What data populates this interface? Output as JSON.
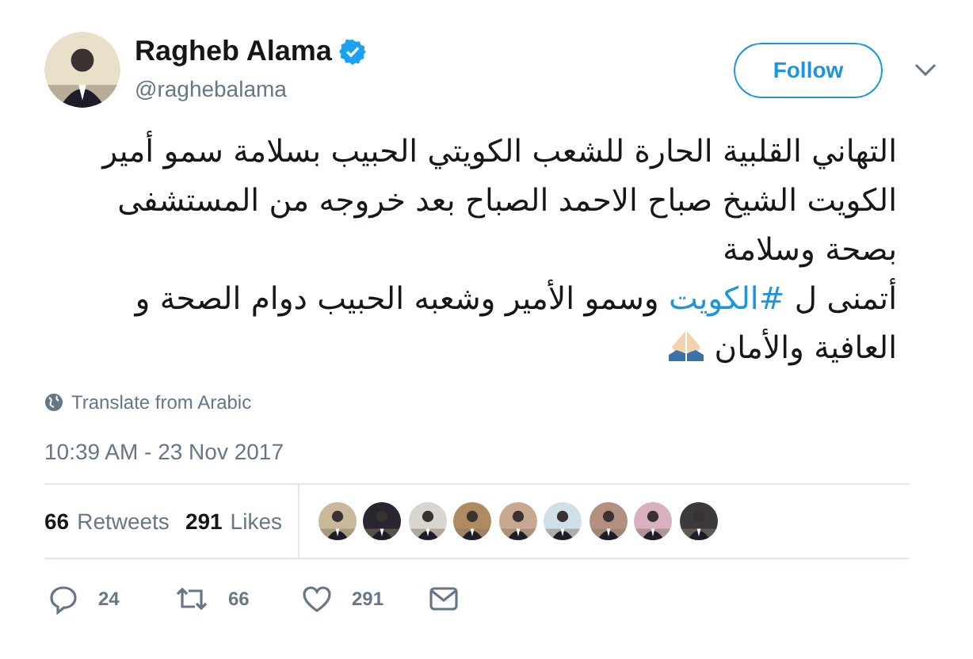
{
  "author": {
    "name": "Ragheb Alama",
    "verified": true,
    "handle": "@raghebalama"
  },
  "follow_button": {
    "label": "Follow"
  },
  "tweet": {
    "paragraphs": [
      {
        "parts": [
          {
            "kind": "text",
            "text": "التهاني القلبية الحارة للشعب الكويتي الحبيب بسلامة سمو أمير الكويت الشيخ صباح الاحمد الصباح بعد خروجه من المستشفى بصحة وسلامة"
          }
        ]
      },
      {
        "parts": [
          {
            "kind": "text",
            "text": "أتمنى ل "
          },
          {
            "kind": "hashtag",
            "text": "#الكويت"
          },
          {
            "kind": "text",
            "text": " وسمو الأمير وشعبه الحبيب دوام  الصحة و العافية والأمان"
          },
          {
            "kind": "emoji"
          }
        ]
      }
    ]
  },
  "translate": "Translate from Arabic",
  "timestamp": "10:39 AM - 23 Nov 2017",
  "stats": {
    "retweets": {
      "count": "66",
      "label": "Retweets"
    },
    "likes": {
      "count": "291",
      "label": "Likes"
    }
  },
  "actions": {
    "reply": {
      "count": "24"
    },
    "retweet": {
      "count": "66"
    },
    "like": {
      "count": "291"
    }
  }
}
